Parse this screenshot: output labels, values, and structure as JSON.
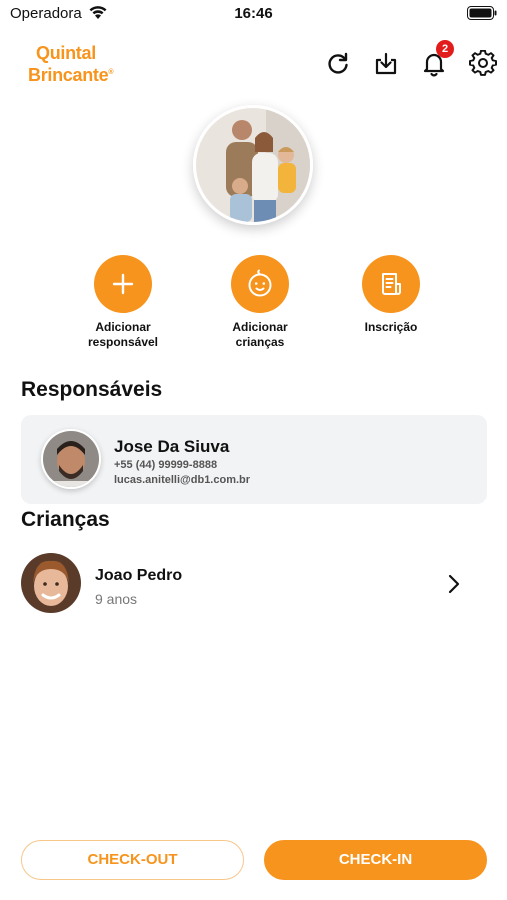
{
  "status_bar": {
    "carrier": "Operadora",
    "time": "16:46"
  },
  "header": {
    "logo_line1": "Quintal",
    "logo_line2": "Brincante",
    "logo_mark": "®",
    "notification_count": "2",
    "icons": [
      "refresh-icon",
      "download-icon",
      "bell-icon",
      "gear-icon"
    ]
  },
  "actions": [
    {
      "label": "Adicionar responsável",
      "icon": "plus-icon"
    },
    {
      "label": "Adicionar crianças",
      "icon": "baby-face-icon"
    },
    {
      "label": "Inscrição",
      "icon": "document-icon"
    }
  ],
  "responsaveis": {
    "title": "Responsáveis",
    "items": [
      {
        "name": "Jose Da Siuva",
        "phone": "+55 (44) 99999-8888",
        "email": "lucas.anitelli@db1.com.br"
      }
    ]
  },
  "criancas": {
    "title": "Crianças",
    "items": [
      {
        "name": "Joao Pedro",
        "age": "9 anos"
      }
    ]
  },
  "buttons": {
    "checkout": "CHECK-OUT",
    "checkin": "CHECK-IN"
  },
  "colors": {
    "accent": "#f7941d",
    "badge": "#e21b1b",
    "card": "#f2f3f5"
  }
}
